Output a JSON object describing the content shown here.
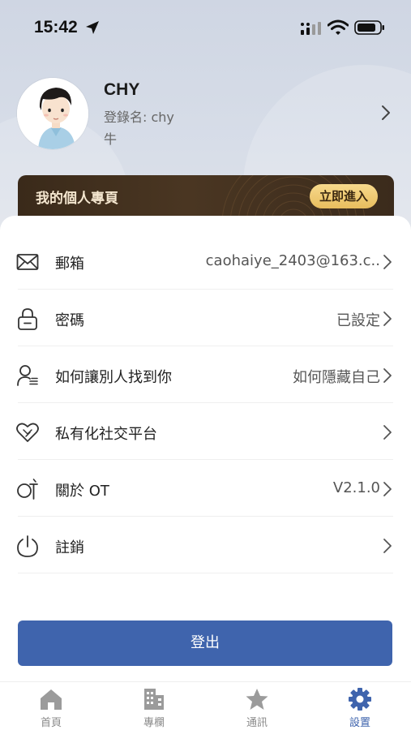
{
  "status_bar": {
    "time": "15:42",
    "icons": [
      "location-arrow-icon",
      "signal-icon",
      "wifi-icon",
      "battery-icon"
    ]
  },
  "profile": {
    "name": "CHY",
    "login": "登錄名: chy",
    "extra": "牛"
  },
  "banner": {
    "title": "我的個人專頁",
    "button": "立即進入"
  },
  "settings": [
    {
      "icon": "mail-icon",
      "label": "郵箱",
      "value": "caohaiye_2403@163.c.."
    },
    {
      "icon": "lock-icon",
      "label": "密碼",
      "value": "已設定"
    },
    {
      "icon": "user-search-icon",
      "label": "如何讓別人找到你",
      "value": "如何隱藏自己"
    },
    {
      "icon": "handshake-heart-icon",
      "label": "私有化社交平台",
      "value": ""
    },
    {
      "icon": "ot-logo-icon",
      "label": "關於 OT",
      "value": "V2.1.0"
    },
    {
      "icon": "power-icon",
      "label": "註銷",
      "value": ""
    }
  ],
  "logout_label": "登出",
  "tabbar": [
    {
      "icon": "home-icon",
      "label": "首頁",
      "active": false
    },
    {
      "icon": "building-icon",
      "label": "專欄",
      "active": false
    },
    {
      "icon": "star-icon",
      "label": "通訊",
      "active": false
    },
    {
      "icon": "gear-icon",
      "label": "設置",
      "active": true
    }
  ],
  "colors": {
    "accent": "#3f64ad",
    "banner_bg": "#3a2a1a",
    "banner_button": "#eec970",
    "header_bg": "#d3d9e5"
  }
}
